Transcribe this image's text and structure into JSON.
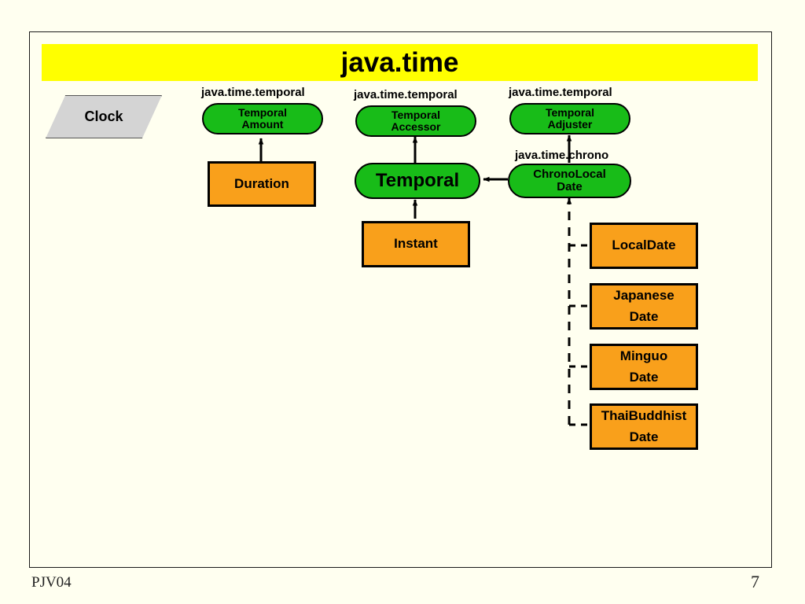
{
  "slide": {
    "title": "java.time",
    "footer_left": "PJV04",
    "footer_right": "7",
    "colors": {
      "background": "#FFFFF0",
      "banner": "#FFFF00",
      "interface_fill": "#18BC18",
      "class_fill": "#F9A01B",
      "clock_fill": "#D4D4D4",
      "line": "#000000"
    }
  },
  "packages": {
    "temporal": "java.time.temporal",
    "chrono": "java.time.chrono"
  },
  "nodes": {
    "clock": {
      "label": "Clock",
      "shape": "parallelogram"
    },
    "temporal_amount": {
      "line1": "Temporal",
      "line2": "Amount",
      "package": "java.time.temporal"
    },
    "temporal_accessor": {
      "line1": "Temporal",
      "line2": "Accessor",
      "package": "java.time.temporal"
    },
    "temporal_adjuster": {
      "line1": "Temporal",
      "line2": "Adjuster",
      "package": "java.time.temporal"
    },
    "temporal": {
      "label": "Temporal"
    },
    "chrono_local_date": {
      "line1": "ChronoLocal",
      "line2": "Date",
      "package": "java.time.chrono"
    },
    "duration": {
      "label": "Duration"
    },
    "instant": {
      "label": "Instant"
    },
    "local_date": {
      "line1": "LocalDate",
      "line2": ""
    },
    "japanese_date": {
      "line1": "Japanese",
      "line2": "Date"
    },
    "minguo_date": {
      "line1": "Minguo",
      "line2": "Date"
    },
    "thai_buddhist_date": {
      "line1": "ThaiBuddhist",
      "line2": "Date"
    }
  },
  "edges": [
    {
      "from": "duration",
      "to": "temporal_amount",
      "style": "solid-arrow"
    },
    {
      "from": "instant",
      "to": "temporal",
      "style": "solid-arrow"
    },
    {
      "from": "temporal",
      "to": "temporal_accessor",
      "style": "solid-arrow"
    },
    {
      "from": "chrono_local_date",
      "to": "temporal",
      "style": "solid-arrow"
    },
    {
      "from": "chrono_local_date",
      "to": "temporal_adjuster",
      "style": "solid-arrow"
    },
    {
      "from": "local_date",
      "to": "chrono_local_date",
      "style": "dashed-arrow"
    },
    {
      "from": "japanese_date",
      "to": "chrono_local_date",
      "style": "dashed-arrow"
    },
    {
      "from": "minguo_date",
      "to": "chrono_local_date",
      "style": "dashed-arrow"
    },
    {
      "from": "thai_buddhist_date",
      "to": "chrono_local_date",
      "style": "dashed-arrow"
    }
  ]
}
